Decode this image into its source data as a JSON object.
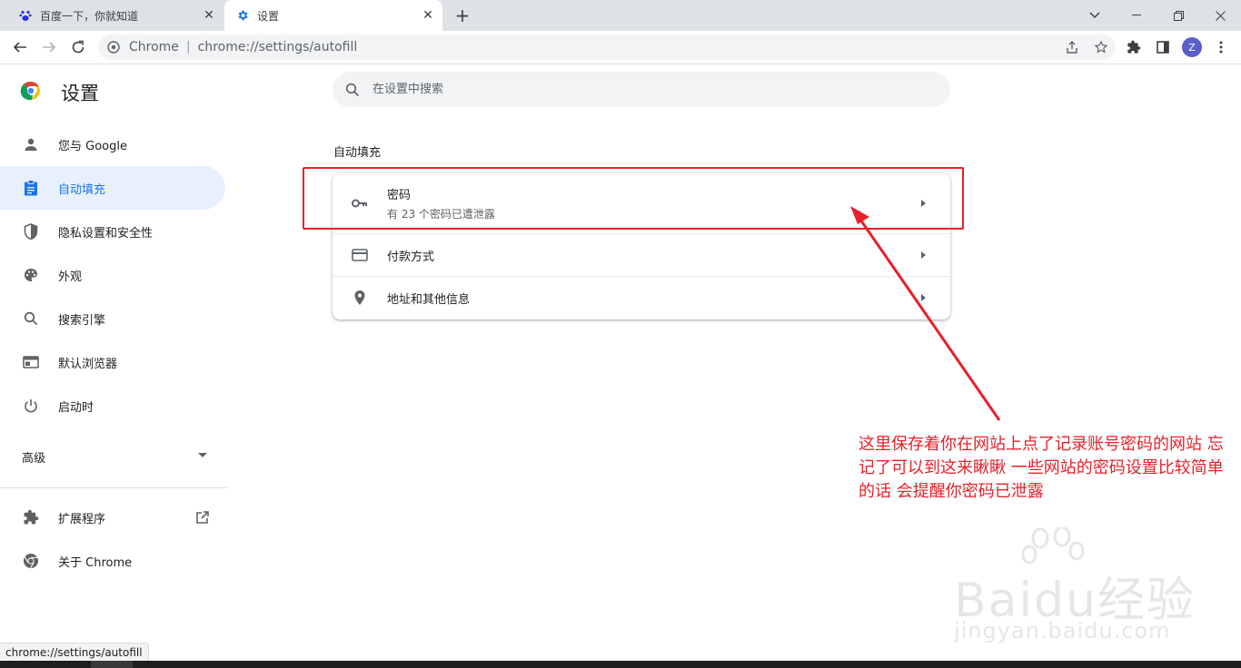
{
  "tabs": [
    {
      "title": "百度一下，你就知道",
      "active": false,
      "icon": "baidu-paw-icon"
    },
    {
      "title": "设置",
      "active": true,
      "icon": "gear-icon"
    }
  ],
  "window_controls": [
    "minimize-icon",
    "restore-icon",
    "close-icon"
  ],
  "toolbar": {
    "chip": "Chrome",
    "url": "chrome://settings/autofill",
    "avatar_letter": "Z"
  },
  "settings": {
    "brand": "设置",
    "search_placeholder": "在设置中搜索",
    "nav": [
      {
        "label": "您与 Google",
        "icon": "person-icon"
      },
      {
        "label": "自动填充",
        "icon": "assignment-icon",
        "active": true
      },
      {
        "label": "隐私设置和安全性",
        "icon": "shield-icon"
      },
      {
        "label": "外观",
        "icon": "palette-icon"
      },
      {
        "label": "搜索引擎",
        "icon": "search-icon"
      },
      {
        "label": "默认浏览器",
        "icon": "browser-icon"
      },
      {
        "label": "启动时",
        "icon": "power-icon"
      }
    ],
    "advanced": "高级",
    "extensions": "扩展程序",
    "about": "关于 Chrome",
    "section_title": "自动填充",
    "rows": [
      {
        "title": "密码",
        "subtitle": "有 23 个密码已遭泄露",
        "icon": "key-icon"
      },
      {
        "title": "付款方式",
        "icon": "credit-card-icon"
      },
      {
        "title": "地址和其他信息",
        "icon": "location-pin-icon"
      }
    ]
  },
  "annotation": {
    "text": "这里保存着你在网站上点了记录账号密码的网站 忘记了可以到这来瞅瞅 一些网站的密码设置比较简单的话 会提醒你密码已泄露",
    "color": "#e8202a"
  },
  "watermark": {
    "main": "Baidu经验",
    "sub": "jingyan.baidu.com"
  },
  "status_bubble": "chrome://settings/autofill",
  "colors": {
    "accent": "#1a73e8",
    "active_nav_bg": "#e8f0fe",
    "annotation": "#e8202a"
  }
}
